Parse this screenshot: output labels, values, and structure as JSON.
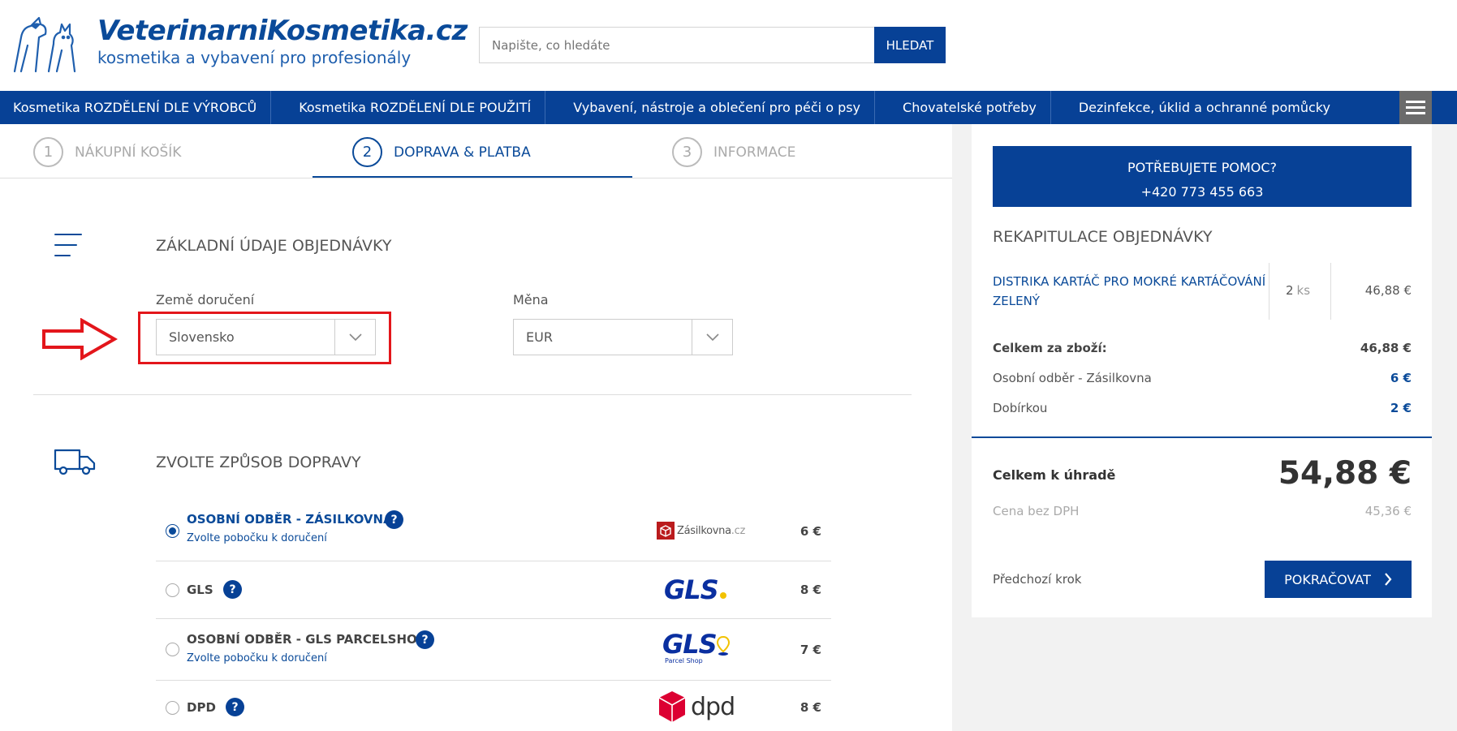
{
  "header": {
    "logo_title": "VeterinarniKosmetika.cz",
    "logo_subtitle": "kosmetika a vybavení pro profesionály",
    "search_placeholder": "Napište, co hledáte",
    "search_button": "HLEDAT"
  },
  "nav": {
    "items": [
      "Kosmetika ROZDĚLENÍ DLE VÝROBCŮ",
      "Kosmetika ROZDĚLENÍ DLE POUŽITÍ",
      "Vybavení, nástroje a oblečení pro péči o psy",
      "Chovatelské potřeby",
      "Dezinfekce, úklid a ochranné pomůcky"
    ]
  },
  "steps": [
    {
      "num": "1",
      "label": "NÁKUPNÍ KOŠÍK"
    },
    {
      "num": "2",
      "label": "DOPRAVA & PLATBA"
    },
    {
      "num": "3",
      "label": "INFORMACE"
    }
  ],
  "basic": {
    "title": "ZÁKLADNÍ ÚDAJE OBJEDNÁVKY",
    "country_label": "Země doručení",
    "country_value": "Slovensko",
    "currency_label": "Měna",
    "currency_value": "EUR"
  },
  "shipping": {
    "title": "ZVOLTE ZPŮSOB DOPRAVY",
    "options": [
      {
        "name": "OSOBNÍ ODBĚR - ZÁSILKOVNA",
        "sub": "Zvolte pobočku k doručení",
        "price": "6 €",
        "logo_text": "Zásilkovna",
        "logo_suffix": ".cz"
      },
      {
        "name": "GLS",
        "sub": "",
        "price": "8 €",
        "logo_text": "GLS"
      },
      {
        "name": "OSOBNÍ ODBĚR - GLS PARCELSHOP",
        "sub": "Zvolte pobočku k doručení",
        "price": "7 €",
        "logo_text": "GLS",
        "logo_sub": "Parcel Shop"
      },
      {
        "name": "DPD",
        "sub": "",
        "price": "8 €",
        "logo_text": "dpd"
      }
    ]
  },
  "sidebar": {
    "help_line1": "POTŘEBUJETE POMOC?",
    "help_line2": "+420 773 455 663",
    "recap_title": "REKAPITULACE OBJEDNÁVKY",
    "item_name": "DISTRIKA KARTÁČ PRO MOKRÉ KARTÁČOVÁNÍ ZELENÝ",
    "item_qty": "2",
    "item_unit": "ks",
    "item_price": "46,88 €",
    "goods_label": "Celkem za zboží:",
    "goods_value": "46,88 €",
    "ship_label": "Osobní odběr - Zásilkovna",
    "ship_value": "6 €",
    "pay_label": "Dobírkou",
    "pay_value": "2 €",
    "total_label": "Celkem k úhradě",
    "total_value": "54,88 €",
    "nett_label": "Cena bez DPH",
    "nett_value": "45,36 €",
    "prev_label": "Předchozí krok",
    "continue_label": "POKRAČOVAT"
  },
  "colors": {
    "brand_blue": "#074196",
    "highlight_red": "#e3161b"
  }
}
